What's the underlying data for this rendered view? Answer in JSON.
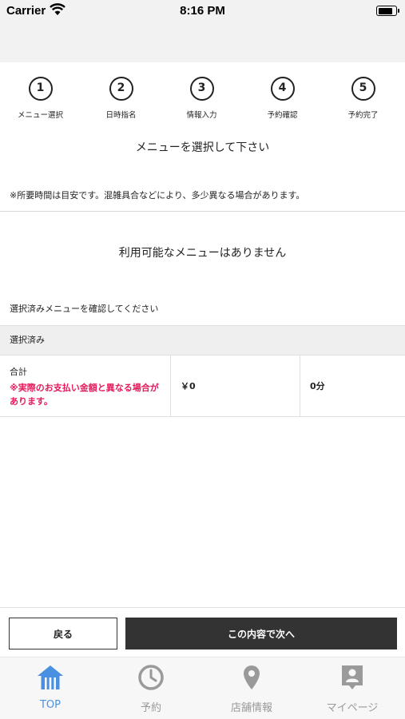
{
  "status_bar": {
    "carrier": "Carrier",
    "time": "8:16 PM",
    "battery_level": 0.85
  },
  "steps": [
    {
      "number": "1",
      "label": "メニュー選択",
      "active": true
    },
    {
      "number": "2",
      "label": "日時指名",
      "active": false
    },
    {
      "number": "3",
      "label": "情報入力",
      "active": false
    },
    {
      "number": "4",
      "label": "予約確認",
      "active": false
    },
    {
      "number": "5",
      "label": "予約完了",
      "active": false
    }
  ],
  "main": {
    "heading": "メニューを選択して下さい",
    "note": "※所要時間は目安です。混雑具合などにより、多少異なる場合があります。",
    "no_menu_text": "利用可能なメニューはありません",
    "confirm_text": "選択済みメニューを確認してください",
    "selected_header": "選択済み",
    "total": {
      "label": "合計",
      "warning": "※実際のお支払い金額と異なる場合があります。",
      "price": "￥0",
      "duration": "0分"
    }
  },
  "actions": {
    "back_label": "戻る",
    "next_label": "この内容で次へ"
  },
  "tabs": [
    {
      "label": "TOP",
      "icon": "home-icon",
      "active": true
    },
    {
      "label": "予約",
      "icon": "clock-icon",
      "active": false
    },
    {
      "label": "店舗情報",
      "icon": "location-pin-icon",
      "active": false
    },
    {
      "label": "マイページ",
      "icon": "profile-icon",
      "active": false
    }
  ],
  "colors": {
    "accent": "#4a90e2",
    "warning": "#e6195a",
    "dark": "#333333",
    "inactive": "#9a9a9a"
  }
}
